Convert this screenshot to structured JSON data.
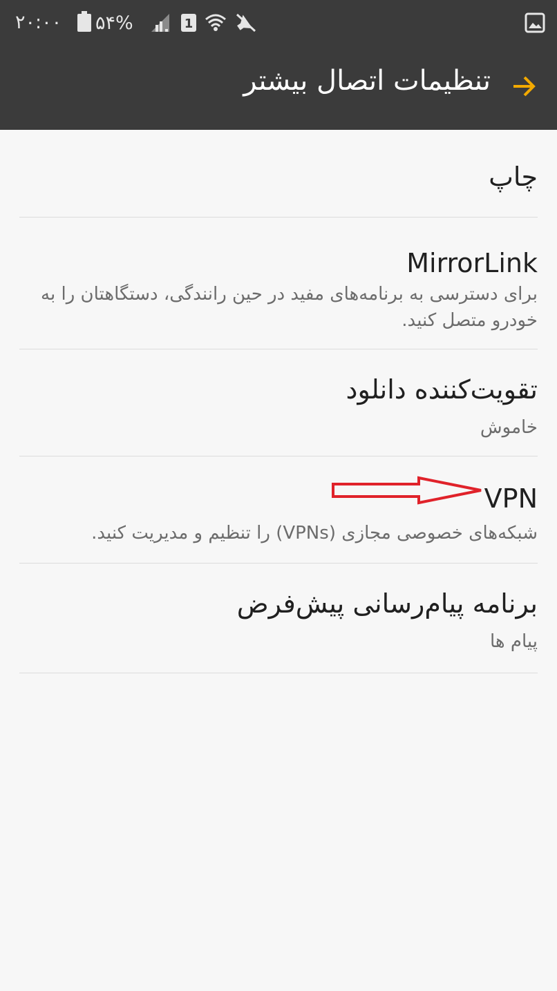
{
  "status_bar": {
    "time": "۲۰:۰۰",
    "battery": "۵۴%",
    "icons": [
      "battery-icon",
      "signal-icon",
      "sim-1-icon",
      "wifi-icon",
      "mute-icon",
      "gallery-icon"
    ]
  },
  "header": {
    "title": "تنظیمات اتصال بیشتر",
    "back_icon": "arrow-right-icon",
    "accent_color": "#f2a900"
  },
  "items": [
    {
      "title": "چاپ",
      "subtitle": ""
    },
    {
      "title": "MirrorLink",
      "subtitle": "برای دسترسی به برنامه‌های مفید در حین رانندگی، دستگاهتان را به خودرو متصل کنید."
    },
    {
      "title": "تقویت‌کننده دانلود",
      "subtitle": "خاموش"
    },
    {
      "title": "VPN",
      "subtitle": "شبکه‌های خصوصی مجازی (VPNs) را تنظیم و مدیریت کنید."
    },
    {
      "title": "برنامه پیام‌رسانی پیش‌فرض",
      "subtitle": "پیام ها"
    }
  ],
  "colors": {
    "bar_background": "#3b3b3b",
    "list_background": "#f7f7f7",
    "annotation_arrow": "#e0222a"
  }
}
